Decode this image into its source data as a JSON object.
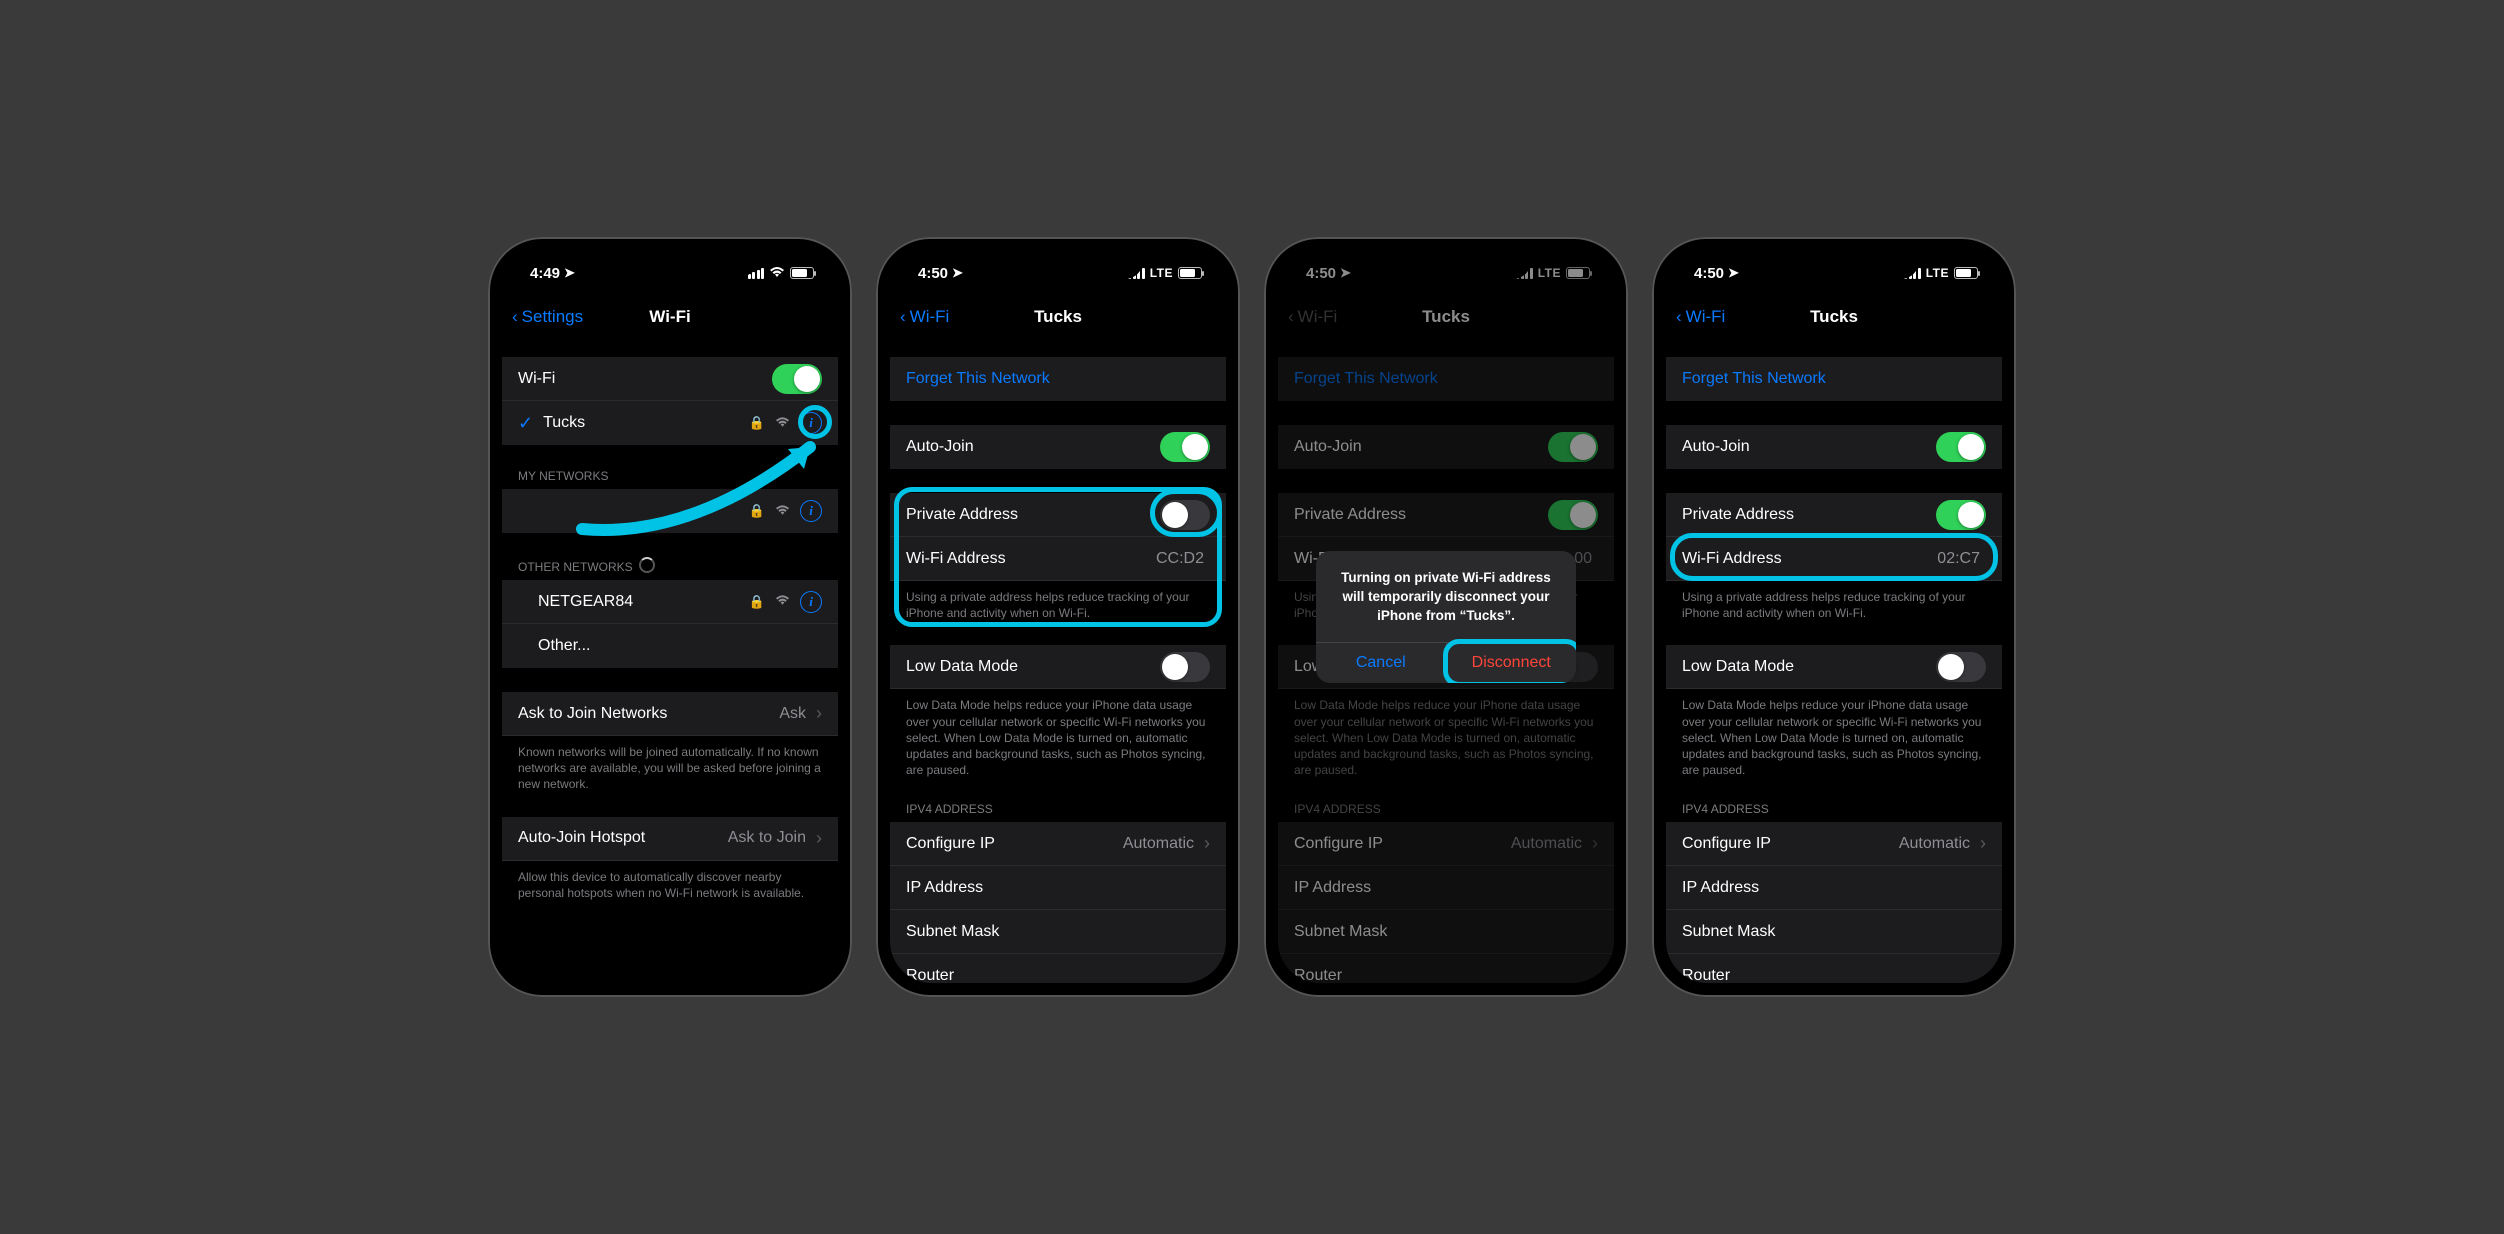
{
  "phones": [
    {
      "statusbar": {
        "time": "4:49",
        "net": "wifi"
      },
      "nav": {
        "back": "Settings",
        "dim": false,
        "title": "Wi-Fi"
      },
      "wifi_list": {
        "wifi_label": "Wi-Fi",
        "wifi_on": true,
        "connected": "Tucks",
        "my_networks_header": "MY NETWORKS",
        "other_header": "OTHER NETWORKS",
        "other_items": [
          "NETGEAR84",
          "Other..."
        ],
        "ask_join": {
          "label": "Ask to Join Networks",
          "value": "Ask",
          "footer": "Known networks will be joined automatically. If no known networks are available, you will be asked before joining a new network."
        },
        "auto_hotspot": {
          "label": "Auto-Join Hotspot",
          "value": "Ask to Join",
          "footer": "Allow this device to automatically discover nearby personal hotspots when no Wi-Fi network is available."
        }
      }
    },
    {
      "statusbar": {
        "time": "4:50",
        "net": "lte"
      },
      "nav": {
        "back": "Wi-Fi",
        "dim": false,
        "title": "Tucks"
      },
      "detail": {
        "forget": "Forget This Network",
        "auto_join": {
          "label": "Auto-Join",
          "on": true
        },
        "private_addr": {
          "label": "Private Address",
          "on": false
        },
        "wifi_addr": {
          "label": "Wi-Fi Address",
          "value": "CC:D2"
        },
        "private_footer": "Using a private address helps reduce tracking of your iPhone and activity when on Wi-Fi.",
        "low_data": {
          "label": "Low Data Mode",
          "on": false
        },
        "low_data_footer": "Low Data Mode helps reduce your iPhone data usage over your cellular network or specific Wi-Fi networks you select. When Low Data Mode is turned on, automatic updates and background tasks, such as Photos syncing, are paused.",
        "ipv4_header": "IPV4 ADDRESS",
        "configure_ip": {
          "label": "Configure IP",
          "value": "Automatic"
        },
        "ip_addr": "IP Address",
        "subnet": "Subnet Mask",
        "router": "Router"
      }
    },
    {
      "statusbar": {
        "time": "4:50",
        "net": "lte"
      },
      "nav": {
        "back": "Wi-Fi",
        "dim": true,
        "title": "Tucks"
      },
      "detail": {
        "forget": "Forget This Network",
        "auto_join": {
          "label": "Auto-Join",
          "on": true
        },
        "private_addr": {
          "label": "Private Address",
          "on": true
        },
        "wifi_addr": {
          "label": "Wi-Fi Address",
          "value": "00"
        },
        "private_footer": "Using a private address helps reduce tracking of your iPhone and activity when on Wi-Fi.",
        "low_data": {
          "label": "Low Data Mode",
          "on": false
        },
        "low_data_footer": "Low Data Mode helps reduce your iPhone data usage over your cellular network or specific Wi-Fi networks you select. When Low Data Mode is turned on, automatic updates and background tasks, such as Photos syncing, are paused.",
        "ipv4_header": "IPV4 ADDRESS",
        "configure_ip": {
          "label": "Configure IP",
          "value": "Automatic"
        },
        "ip_addr": "IP Address",
        "subnet": "Subnet Mask",
        "router": "Router"
      },
      "alert": {
        "message": "Turning on private Wi-Fi address will temporarily disconnect your iPhone from “Tucks”.",
        "cancel": "Cancel",
        "confirm": "Disconnect"
      }
    },
    {
      "statusbar": {
        "time": "4:50",
        "net": "lte"
      },
      "nav": {
        "back": "Wi-Fi",
        "dim": false,
        "title": "Tucks"
      },
      "detail": {
        "forget": "Forget This Network",
        "auto_join": {
          "label": "Auto-Join",
          "on": true
        },
        "private_addr": {
          "label": "Private Address",
          "on": true
        },
        "wifi_addr": {
          "label": "Wi-Fi Address",
          "value": "02:C7"
        },
        "private_footer": "Using a private address helps reduce tracking of your iPhone and activity when on Wi-Fi.",
        "low_data": {
          "label": "Low Data Mode",
          "on": false
        },
        "low_data_footer": "Low Data Mode helps reduce your iPhone data usage over your cellular network or specific Wi-Fi networks you select. When Low Data Mode is turned on, automatic updates and background tasks, such as Photos syncing, are paused.",
        "ipv4_header": "IPV4 ADDRESS",
        "configure_ip": {
          "label": "Configure IP",
          "value": "Automatic"
        },
        "ip_addr": "IP Address",
        "subnet": "Subnet Mask",
        "router": "Router"
      }
    }
  ]
}
